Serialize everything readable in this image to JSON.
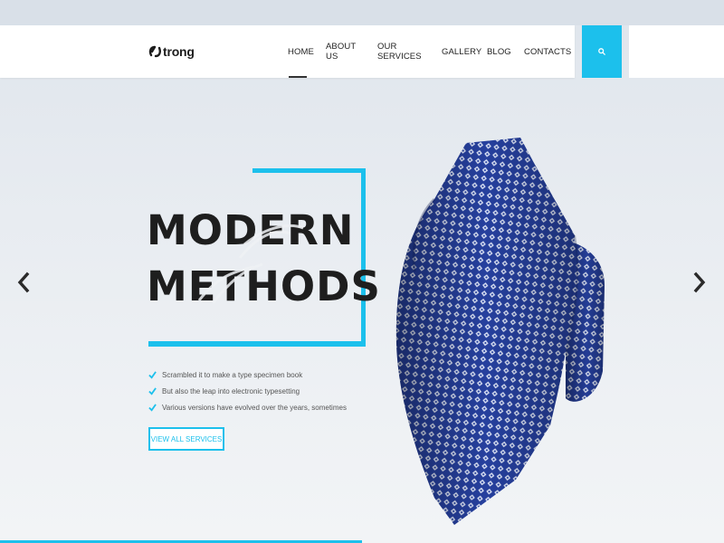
{
  "brand": {
    "logo_text": "trong"
  },
  "nav": {
    "items": [
      {
        "label": "Home",
        "active": true
      },
      {
        "label": "About us",
        "active": false
      },
      {
        "label": "Our services",
        "active": false
      },
      {
        "label": "Gallery",
        "active": false
      },
      {
        "label": "Blog",
        "active": false
      },
      {
        "label": "Contacts",
        "active": false
      }
    ],
    "search_icon": "search-icon"
  },
  "hero": {
    "headline_line1": "MODERN",
    "headline_line2": "METHODS",
    "features": [
      "Scrambled it to make a type specimen book",
      "But also the leap into electronic typesetting",
      "Various versions have evolved over the years, sometimes"
    ],
    "cta_label": "View all services",
    "image": "blue-patterned-necktie"
  },
  "slider": {
    "prev_icon": "chevron-left-icon",
    "next_icon": "chevron-right-icon"
  },
  "colors": {
    "accent": "#1cc0ec",
    "tie": "#2d45a8",
    "text_dark": "#1e1e1e"
  }
}
